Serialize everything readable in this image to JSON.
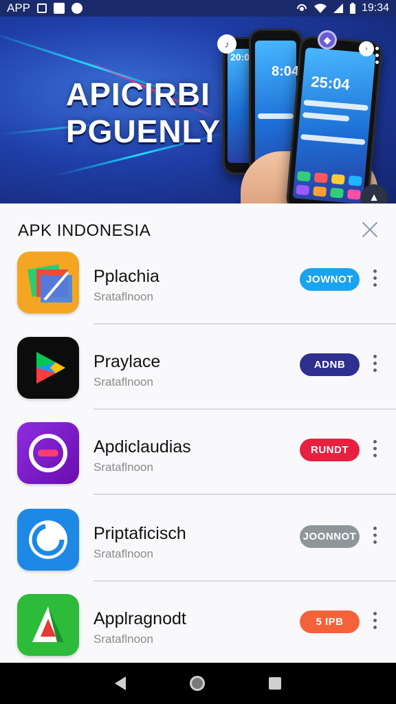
{
  "status_bar": {
    "left_label": "APP",
    "time": "19:34",
    "icons": [
      "gallery-icon",
      "bird-icon",
      "sync-icon",
      "hotspot-icon",
      "wifi-icon",
      "signal-icon",
      "battery-icon"
    ]
  },
  "banner": {
    "line1": "APICIRBI",
    "line2": "PGUENLY",
    "phone_clocks": [
      "20:0",
      "8:04",
      "25:04"
    ],
    "colors": {
      "bg": "#1f3ea8",
      "streak": "#19e0ff",
      "accent": "#ff3f8f"
    }
  },
  "sheet": {
    "title": "APK INDONESIA",
    "apps": [
      {
        "name": "Pplachia",
        "subtitle": "Srataflnoon",
        "button": "JOWNOT",
        "button_color": "#1aa3f0",
        "icon": "messages-icon"
      },
      {
        "name": "Praylace",
        "subtitle": "Srataflnoon",
        "button": "ADNB",
        "button_color": "#2e2f8f",
        "icon": "play-store-icon"
      },
      {
        "name": "Apdiclaudias",
        "subtitle": "Srataflnoon",
        "button": "RUNDT",
        "button_color": "#e8203f",
        "icon": "chat-bubble-icon"
      },
      {
        "name": "Priptaficisch",
        "subtitle": "Srataflnoon",
        "button": "JOONNOT",
        "button_color": "#8e969a",
        "icon": "refresh-app-icon"
      },
      {
        "name": "Applragnodt",
        "subtitle": "Srataflnoon",
        "button": "5 IPB",
        "button_color": "#f4623a",
        "icon": "pen-app-icon"
      }
    ]
  },
  "navbar": {
    "icons": [
      "back-icon",
      "home-icon",
      "recents-icon"
    ]
  }
}
